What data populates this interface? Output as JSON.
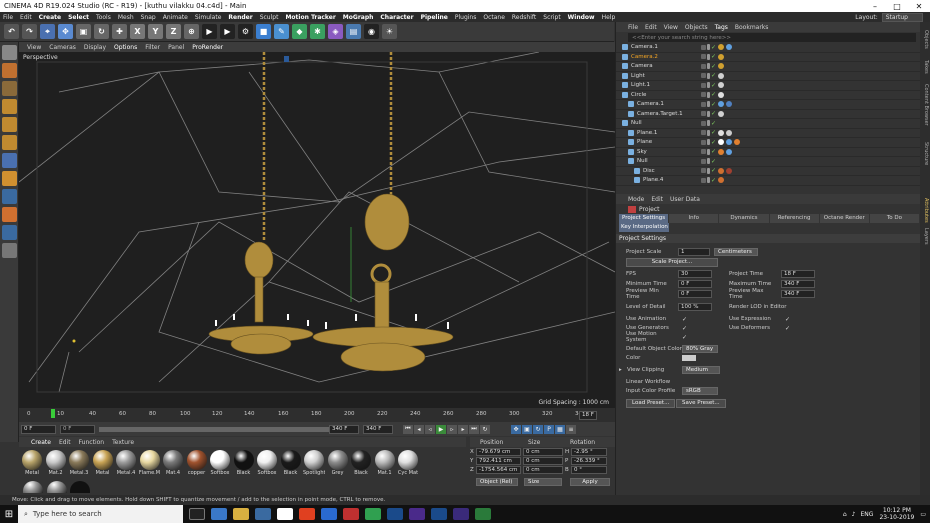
{
  "window": {
    "title": "CINEMA 4D R19.024 Studio (RC - R19) - [kuthu vilakku 04.c4d] - Main",
    "min": "–",
    "max": "□",
    "close": "✕"
  },
  "menubar": {
    "items": [
      "File",
      "Edit",
      "Create",
      "Select",
      "Tools",
      "Mesh",
      "Snap",
      "Animate",
      "Simulate",
      "Render",
      "Sculpt",
      "Motion Tracker",
      "MoGraph",
      "Character",
      "Pipeline",
      "Plugins",
      "Octane",
      "Redshift",
      "Script",
      "Window",
      "Help"
    ],
    "layout_label": "Layout:",
    "layout_value": "Startup"
  },
  "toolbar": {
    "axis_x": "X",
    "axis_y": "Y",
    "axis_z": "Z"
  },
  "viewport": {
    "menu": [
      "View",
      "Cameras",
      "Display",
      "Options",
      "Filter",
      "Panel",
      "ProRender"
    ],
    "label": "Perspective",
    "grid_spacing": "Grid Spacing : 1000 cm"
  },
  "timeline": {
    "ticks": [
      "0",
      "10",
      "20",
      "30",
      "40",
      "50",
      "60",
      "70",
      "80",
      "90",
      "100",
      "110",
      "120",
      "130",
      "140",
      "150",
      "160",
      "170",
      "180",
      "190",
      "200",
      "210",
      "220",
      "230",
      "240",
      "250",
      "260",
      "270",
      "280",
      "290",
      "300",
      "310",
      "320",
      "330",
      "340"
    ],
    "current_frame": "18 F",
    "start_field": "0 F",
    "end_field": "340 F",
    "end_field2": "340 F",
    "start_field2": "0 F"
  },
  "materials": {
    "menu": [
      "Create",
      "Edit",
      "Function",
      "Texture"
    ],
    "items": [
      {
        "label": "Metal",
        "color": "#b8a46a"
      },
      {
        "label": "Mat.2",
        "color": "#c9c9c9"
      },
      {
        "label": "Metal.3",
        "color": "#8a7a5a"
      },
      {
        "label": "Metal",
        "color": "#c9a455"
      },
      {
        "label": "Metal.4",
        "color": "#9c9c9c"
      },
      {
        "label": "Flame.M",
        "color": "#e8d8a0"
      },
      {
        "label": "Mat.4",
        "color": "#7a7a7a"
      },
      {
        "label": "copper",
        "color": "#a0522d"
      },
      {
        "label": "Softbox",
        "color": "#ffffff"
      },
      {
        "label": "Black",
        "color": "#111111"
      },
      {
        "label": "Softbox",
        "color": "#f0f0f0"
      },
      {
        "label": "Black",
        "color": "#1a1a1a"
      },
      {
        "label": "Spotlight",
        "color": "#d0d0d0"
      },
      {
        "label": "Grey",
        "color": "#8c8c8c"
      },
      {
        "label": "Black",
        "color": "#222222"
      },
      {
        "label": "Mat.1",
        "color": "#bbbbbb"
      },
      {
        "label": "Cyc Mat",
        "color": "#e0e0e0"
      }
    ]
  },
  "coordinates": {
    "headers": [
      "Position",
      "Size",
      "Rotation"
    ],
    "rows": [
      {
        "axis": "X",
        "pos": "-79.679 cm",
        "size": "0 cm",
        "rot_label": "H",
        "rot": "-2.95 °"
      },
      {
        "axis": "Y",
        "pos": "792.411 cm",
        "size": "0 cm",
        "rot_label": "P",
        "rot": "-26.339 °"
      },
      {
        "axis": "Z",
        "pos": "-1754.564 cm",
        "size": "0 cm",
        "rot_label": "B",
        "rot": "0 °"
      }
    ],
    "mode": "Object (Rel)",
    "size_mode": "Size",
    "apply": "Apply"
  },
  "statusbar": "Move: Click and drag to move elements. Hold down SHIFT to quantize movement / add to the selection in point mode, CTRL to remove.",
  "objects": {
    "menu": [
      "File",
      "Edit",
      "View",
      "Objects",
      "Tags",
      "Bookmarks"
    ],
    "search": "<<Enter your search string here>>",
    "items": [
      {
        "name": "Camera.1",
        "sel": false,
        "indent": 0
      },
      {
        "name": "Camera.2",
        "sel": true,
        "indent": 0
      },
      {
        "name": "Camera",
        "sel": false,
        "indent": 0
      },
      {
        "name": "Light",
        "sel": false,
        "indent": 0
      },
      {
        "name": "Light.1",
        "sel": false,
        "indent": 0
      },
      {
        "name": "Circle",
        "sel": false,
        "indent": 0
      },
      {
        "name": "Camera.1",
        "sel": false,
        "indent": 1
      },
      {
        "name": "Camera.Target.1",
        "sel": false,
        "indent": 1
      },
      {
        "name": "Null",
        "sel": false,
        "indent": 0
      },
      {
        "name": "Plane.1",
        "sel": false,
        "indent": 1
      },
      {
        "name": "Plane",
        "sel": false,
        "indent": 1
      },
      {
        "name": "Sky",
        "sel": false,
        "indent": 1
      },
      {
        "name": "Null",
        "sel": false,
        "indent": 1
      },
      {
        "name": "Disc",
        "sel": false,
        "indent": 2
      },
      {
        "name": "Plane.4",
        "sel": false,
        "indent": 2
      }
    ]
  },
  "attributes": {
    "menu": [
      "Mode",
      "Edit",
      "User Data"
    ],
    "title": "Project",
    "tabs": [
      "Project Settings",
      "Info",
      "Dynamics",
      "Referencing",
      "Octane Render",
      "To Do"
    ],
    "sub_tab": "Key Interpolation",
    "section": "Project Settings",
    "project_scale_label": "Project Scale",
    "project_scale_value": "1",
    "project_scale_unit": "Centimeters",
    "scale_button": "Scale Project...",
    "fps_label": "FPS",
    "fps": "30",
    "project_time_label": "Project Time",
    "project_time": "18 F",
    "min_time_label": "Minimum Time",
    "min_time": "0 F",
    "max_time_label": "Maximum Time",
    "max_time": "340 F",
    "prev_min_label": "Preview Min Time",
    "prev_min": "0 F",
    "prev_max_label": "Preview Max Time",
    "prev_max": "340 F",
    "lod_label": "Level of Detail",
    "lod": "100 %",
    "render_lod_label": "Render LOD in Editor",
    "use_anim_label": "Use Animation",
    "use_expr_label": "Use Expression",
    "use_gen_label": "Use Generators",
    "use_def_label": "Use Deformers",
    "use_motion_label": "Use Motion System",
    "def_color_label": "Default Object Color",
    "def_color": "80% Gray",
    "color_label": "Color",
    "view_clip_label": "View Clipping",
    "view_clip": "Medium",
    "linear_label": "Linear Workflow",
    "input_profile_label": "Input Color Profile",
    "input_profile": "sRGB",
    "load_preset": "Load Preset...",
    "save_preset": "Save Preset...",
    "check": "✓"
  },
  "rightstrip": [
    "Objects",
    "Takes",
    "Content Browser",
    "Structure",
    "Attributes",
    "Layers"
  ],
  "taskbar": {
    "search": "Type here to search",
    "lang": "ENG",
    "time": "10:12 PM",
    "date": "23-10-2019"
  },
  "colors": {
    "accent_orange": "#f5a623",
    "tab_active": "#5a6a85",
    "gold": "#b08d3c"
  }
}
